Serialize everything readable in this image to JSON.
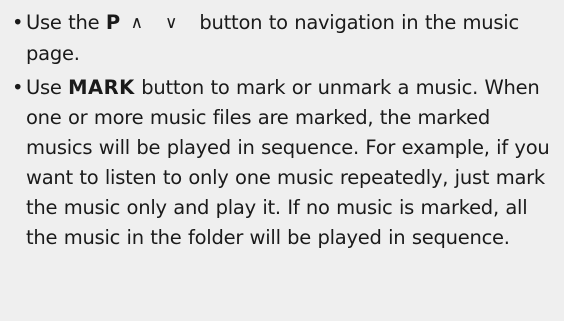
{
  "instructions": [
    {
      "bullet": "•",
      "prefix": "Use the ",
      "key_label": "P",
      "arrows": "∧ ∨",
      "suffix": "button to navigation in the music page."
    },
    {
      "bullet": "•",
      "prefix": "Use ",
      "key_label": "MARK",
      "suffix": " button to mark or unmark a music. When one or more music files are marked, the marked musics will be played in sequence. For example, if you want to listen to only one music repeatedly, just mark the music only and play it. If no music is marked, all the music in the folder will be played in sequence."
    }
  ]
}
